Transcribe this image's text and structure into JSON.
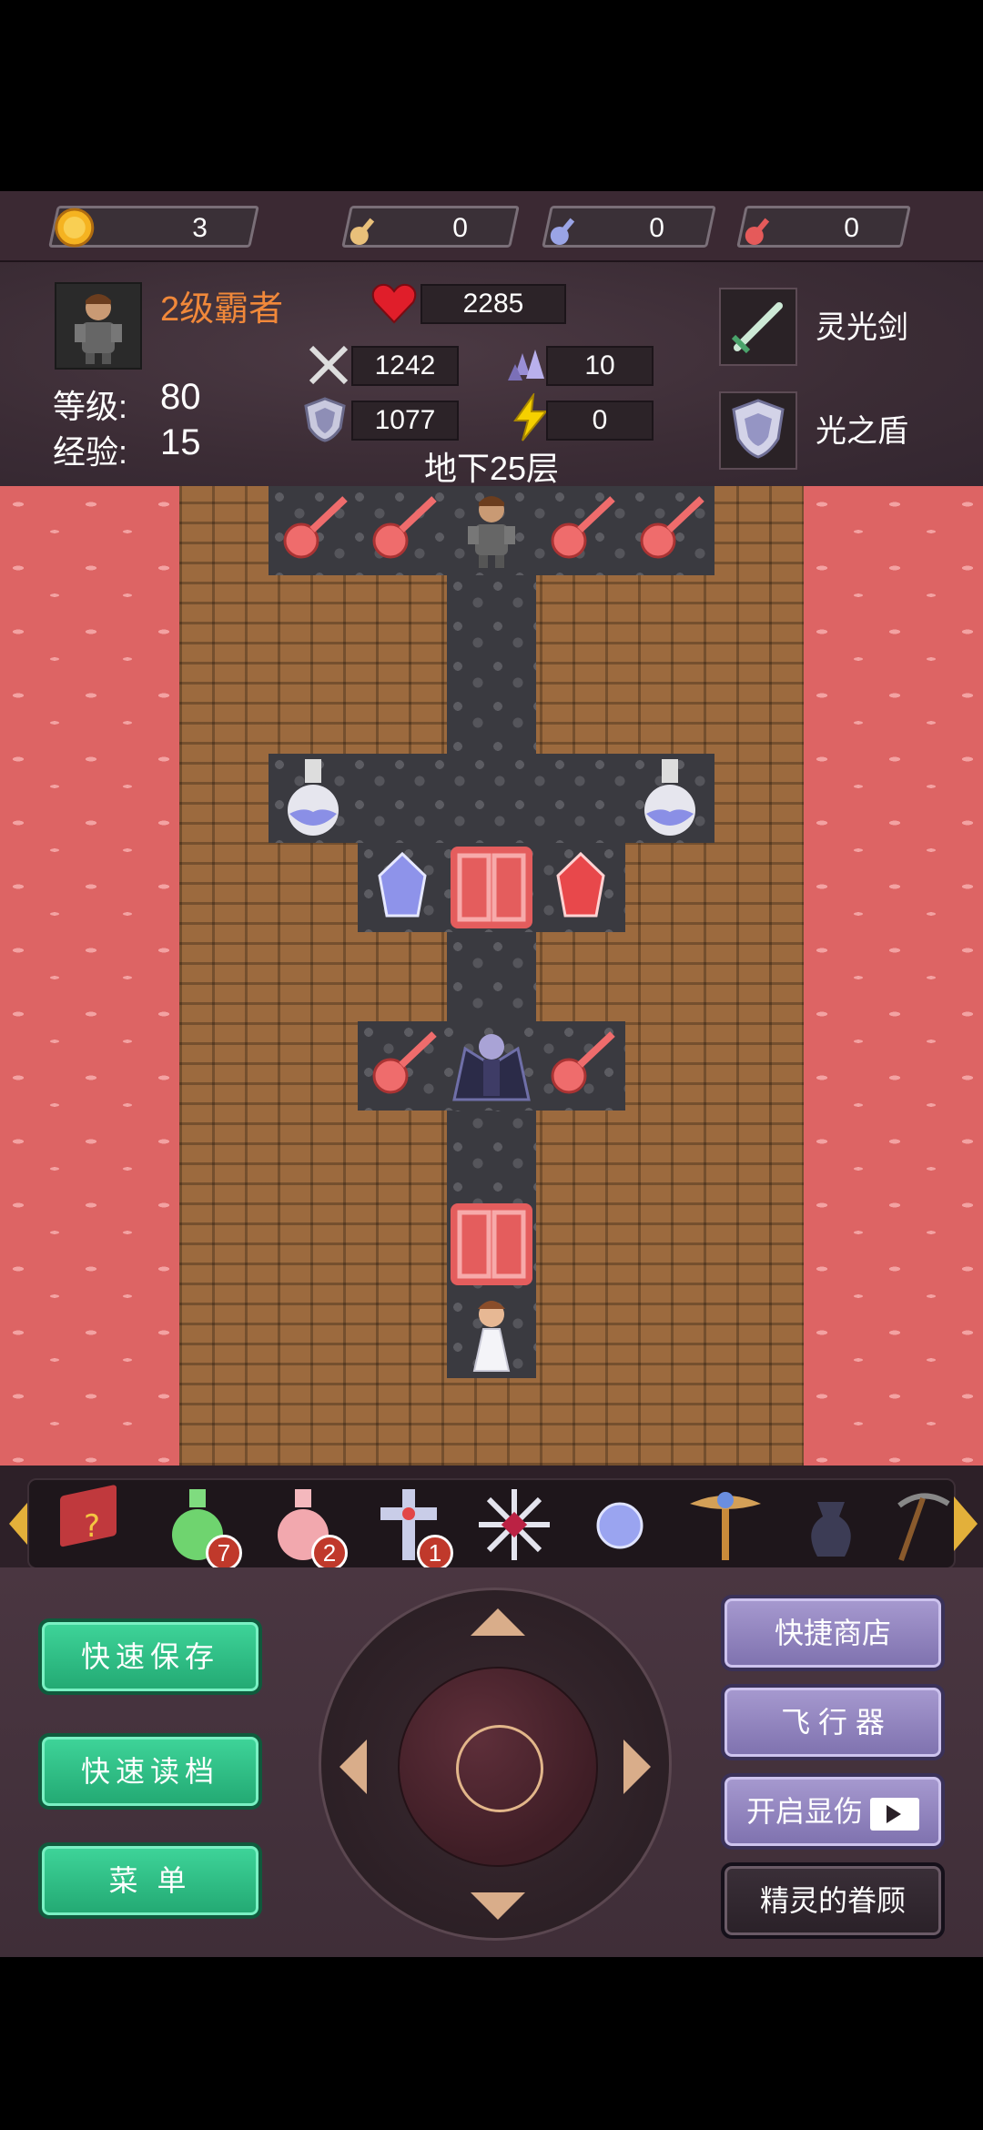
{
  "resources": {
    "gold": {
      "icon": "gold-coin-icon",
      "value": "3"
    },
    "yellow_key": {
      "icon": "yellow-key-icon",
      "value": "0"
    },
    "blue_key": {
      "icon": "blue-key-icon",
      "value": "0"
    },
    "red_key": {
      "icon": "red-key-icon",
      "value": "0"
    }
  },
  "hero": {
    "rank": "2级霸者",
    "level_label": "等级:",
    "level": "80",
    "exp_label": "经验:",
    "exp": "15",
    "hp": "2285",
    "attack": "1242",
    "defense": "1077",
    "magic_defense": "10",
    "agility": "0"
  },
  "floor": "地下25层",
  "equipment": {
    "weapon": "灵光剑",
    "shield": "光之盾"
  },
  "items": [
    {
      "name": "monster-manual-icon",
      "count": ""
    },
    {
      "name": "green-potion-icon",
      "count": "7"
    },
    {
      "name": "pink-potion-icon",
      "count": "2"
    },
    {
      "name": "holy-cross-icon",
      "count": "1"
    },
    {
      "name": "snowflake-icon",
      "count": ""
    },
    {
      "name": "orb-icon",
      "count": ""
    },
    {
      "name": "winged-staff-icon",
      "count": ""
    },
    {
      "name": "dark-vase-icon",
      "count": ""
    },
    {
      "name": "pickaxe-icon",
      "count": ""
    }
  ],
  "buttons": {
    "quick_save": "快速保存",
    "quick_load": "快速读档",
    "menu": "菜  单",
    "quick_shop": "快捷商店",
    "flyer": "飞 行 器",
    "show_damage": "开启显伤",
    "fairy_blessing": "精灵的眷顾"
  },
  "colors": {
    "rank": "#f0883a",
    "lava": "#dd6464",
    "wall": "#9c6a3e",
    "floor_tile": "#3a3a40",
    "green_button": "#2bbf85",
    "purple_button": "#8f83c0"
  }
}
